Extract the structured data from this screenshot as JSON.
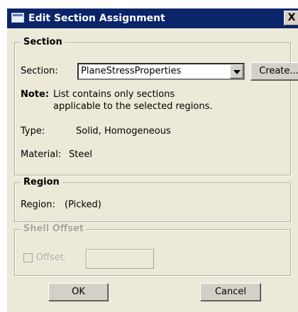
{
  "window": {
    "title": "Edit Section Assignment",
    "close_glyph": "X"
  },
  "section_group": {
    "legend": "Section",
    "section_label": "Section:",
    "section_value": "PlaneStressProperties",
    "create_button": "Create...",
    "note_label": "Note:",
    "note_line1": "List contains only sections",
    "note_line2": "applicable to the selected regions.",
    "type_label": "Type:",
    "type_value": "Solid, Homogeneous",
    "material_label": "Material:",
    "material_value": "Steel"
  },
  "region_group": {
    "legend": "Region",
    "region_label": "Region:",
    "region_value": "(Picked)"
  },
  "shell_offset_group": {
    "legend": "Shell Offset",
    "offset_label": "Offset:",
    "offset_value": ""
  },
  "buttons": {
    "ok": "OK",
    "cancel": "Cancel"
  }
}
